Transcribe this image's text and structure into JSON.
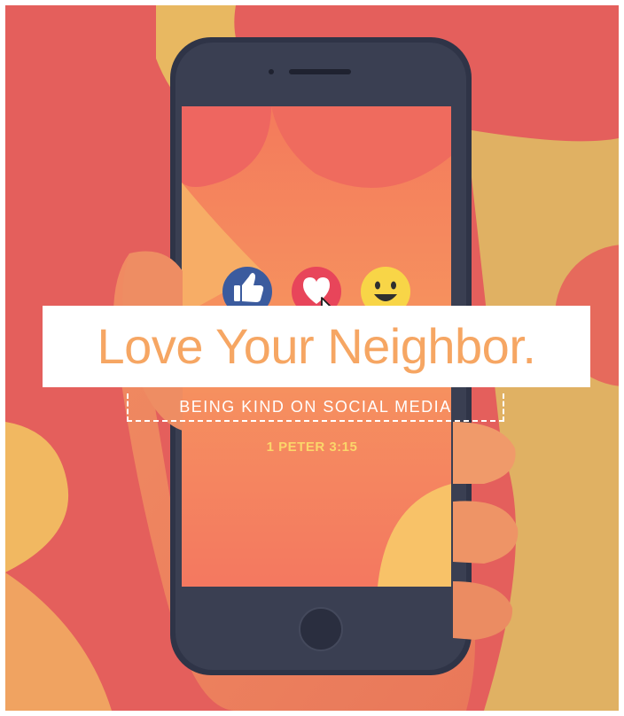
{
  "poster": {
    "title": "Love Your Neighbor.",
    "subtitle": "BEING KIND ON SOCIAL MEDIA",
    "reference": "1 PETER 3:15"
  },
  "reactions": [
    {
      "name": "like",
      "icon": "thumbs-up-icon"
    },
    {
      "name": "love",
      "icon": "heart-icon"
    },
    {
      "name": "haha",
      "icon": "smiley-face-icon"
    }
  ],
  "colors": {
    "title": "#f6a663",
    "reference": "#fbd66a",
    "like": "#3b5b9e",
    "love": "#e8455a",
    "smiley": "#f8d547",
    "phone_frame": "#2f3447",
    "bg_red": "#e45f5c",
    "bg_yellow": "#e2b35f"
  }
}
